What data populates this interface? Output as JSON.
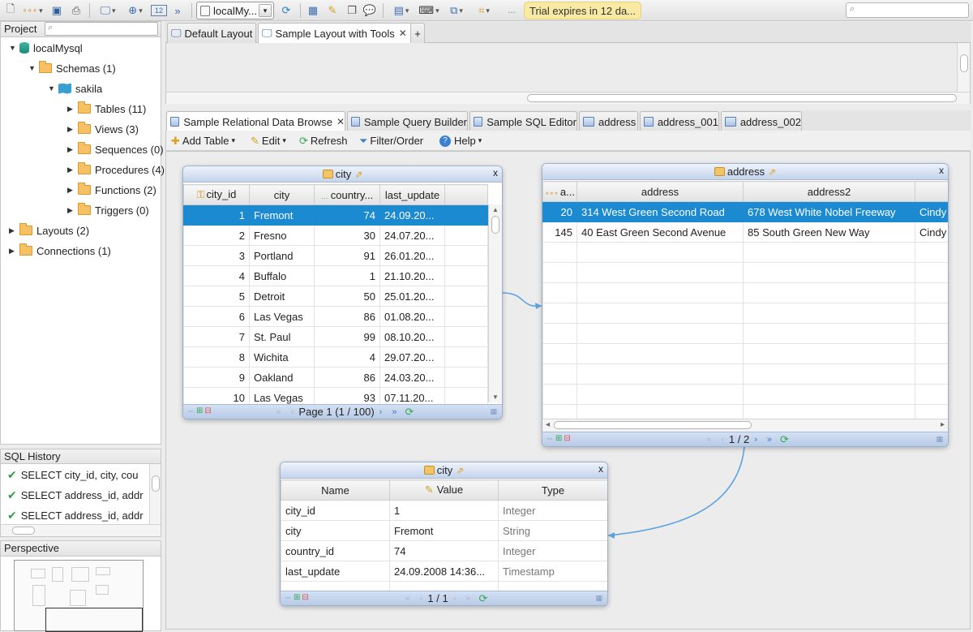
{
  "toolbar": {
    "connection": "localMy...",
    "trial": "Trial expires in 12 da..."
  },
  "project": {
    "header": "Project",
    "tree": [
      {
        "label": "localMysql",
        "level": 0,
        "icon": "database-icon",
        "expanded": true
      },
      {
        "label": "Schemas (1)",
        "level": 1,
        "icon": "folder-icon",
        "expanded": true
      },
      {
        "label": "sakila",
        "level": 2,
        "icon": "schema-icon",
        "expanded": true
      },
      {
        "label": "Tables (11)",
        "level": 3,
        "icon": "folder-icon",
        "expanded": false
      },
      {
        "label": "Views (3)",
        "level": 3,
        "icon": "folder-icon",
        "expanded": false
      },
      {
        "label": "Sequences (0)",
        "level": 3,
        "icon": "folder-icon",
        "expanded": false
      },
      {
        "label": "Procedures (4)",
        "level": 3,
        "icon": "folder-icon",
        "expanded": false
      },
      {
        "label": "Functions (2)",
        "level": 3,
        "icon": "folder-icon",
        "expanded": false
      },
      {
        "label": "Triggers (0)",
        "level": 3,
        "icon": "folder-icon",
        "expanded": false
      },
      {
        "label": "Layouts (2)",
        "level": 0,
        "icon": "folder-icon",
        "expanded": false
      },
      {
        "label": "Connections (1)",
        "level": 0,
        "icon": "folder-icon",
        "expanded": false
      }
    ]
  },
  "sql_history": {
    "header": "SQL History",
    "items": [
      "SELECT city_id, city, cou",
      "SELECT address_id, addr",
      "SELECT address_id, addr"
    ]
  },
  "perspective": {
    "header": "Perspective"
  },
  "layout_tabs": [
    {
      "label": "Default Layout",
      "active": false
    },
    {
      "label": "Sample Layout with Tools",
      "active": true,
      "closable": true
    },
    {
      "label": "+",
      "active": false
    }
  ],
  "editor_tabs": [
    {
      "label": "Sample Relational Data Browse",
      "active": true,
      "closable": true
    },
    {
      "label": "Sample Query Builder"
    },
    {
      "label": "Sample SQL Editor"
    },
    {
      "label": "address"
    },
    {
      "label": "address_001"
    },
    {
      "label": "address_002"
    }
  ],
  "subtoolbar": {
    "add_table": "Add Table",
    "edit": "Edit",
    "refresh": "Refresh",
    "filter": "Filter/Order",
    "help": "Help"
  },
  "city_frame": {
    "title": "city",
    "columns": [
      "city_id",
      "city",
      "country...",
      "last_update"
    ],
    "rows": [
      [
        "1",
        "Fremont",
        "74",
        "24.09.20..."
      ],
      [
        "2",
        "Fresno",
        "30",
        "24.07.20..."
      ],
      [
        "3",
        "Portland",
        "91",
        "26.01.20..."
      ],
      [
        "4",
        "Buffalo",
        "1",
        "21.10.20..."
      ],
      [
        "5",
        "Detroit",
        "50",
        "25.01.20..."
      ],
      [
        "6",
        "Las Vegas",
        "86",
        "01.08.20..."
      ],
      [
        "7",
        "St. Paul",
        "99",
        "08.10.20..."
      ],
      [
        "8",
        "Wichita",
        "4",
        "29.07.20..."
      ],
      [
        "9",
        "Oakland",
        "86",
        "24.03.20..."
      ],
      [
        "10",
        "Las Vegas",
        "93",
        "07.11.20..."
      ]
    ],
    "page": "Page 1 (1 / 100)"
  },
  "address_frame": {
    "title": "address",
    "columns": [
      "a...",
      "address",
      "address2",
      ""
    ],
    "rows": [
      [
        "20",
        "314 West Green Second Road",
        "678 West White Nobel Freeway",
        "Cindy"
      ],
      [
        "145",
        "40 East Green Second Avenue",
        "85 South Green New Way",
        "Cindy"
      ]
    ],
    "page": "1 / 2"
  },
  "detail_frame": {
    "title": "city",
    "columns": [
      "Name",
      "Value",
      "Type"
    ],
    "rows": [
      [
        "city_id",
        "1",
        "Integer"
      ],
      [
        "city",
        "Fremont",
        "String"
      ],
      [
        "country_id",
        "74",
        "Integer"
      ],
      [
        "last_update",
        "24.09.2008 14:36...",
        "Timestamp"
      ]
    ],
    "page": "1 / 1"
  }
}
